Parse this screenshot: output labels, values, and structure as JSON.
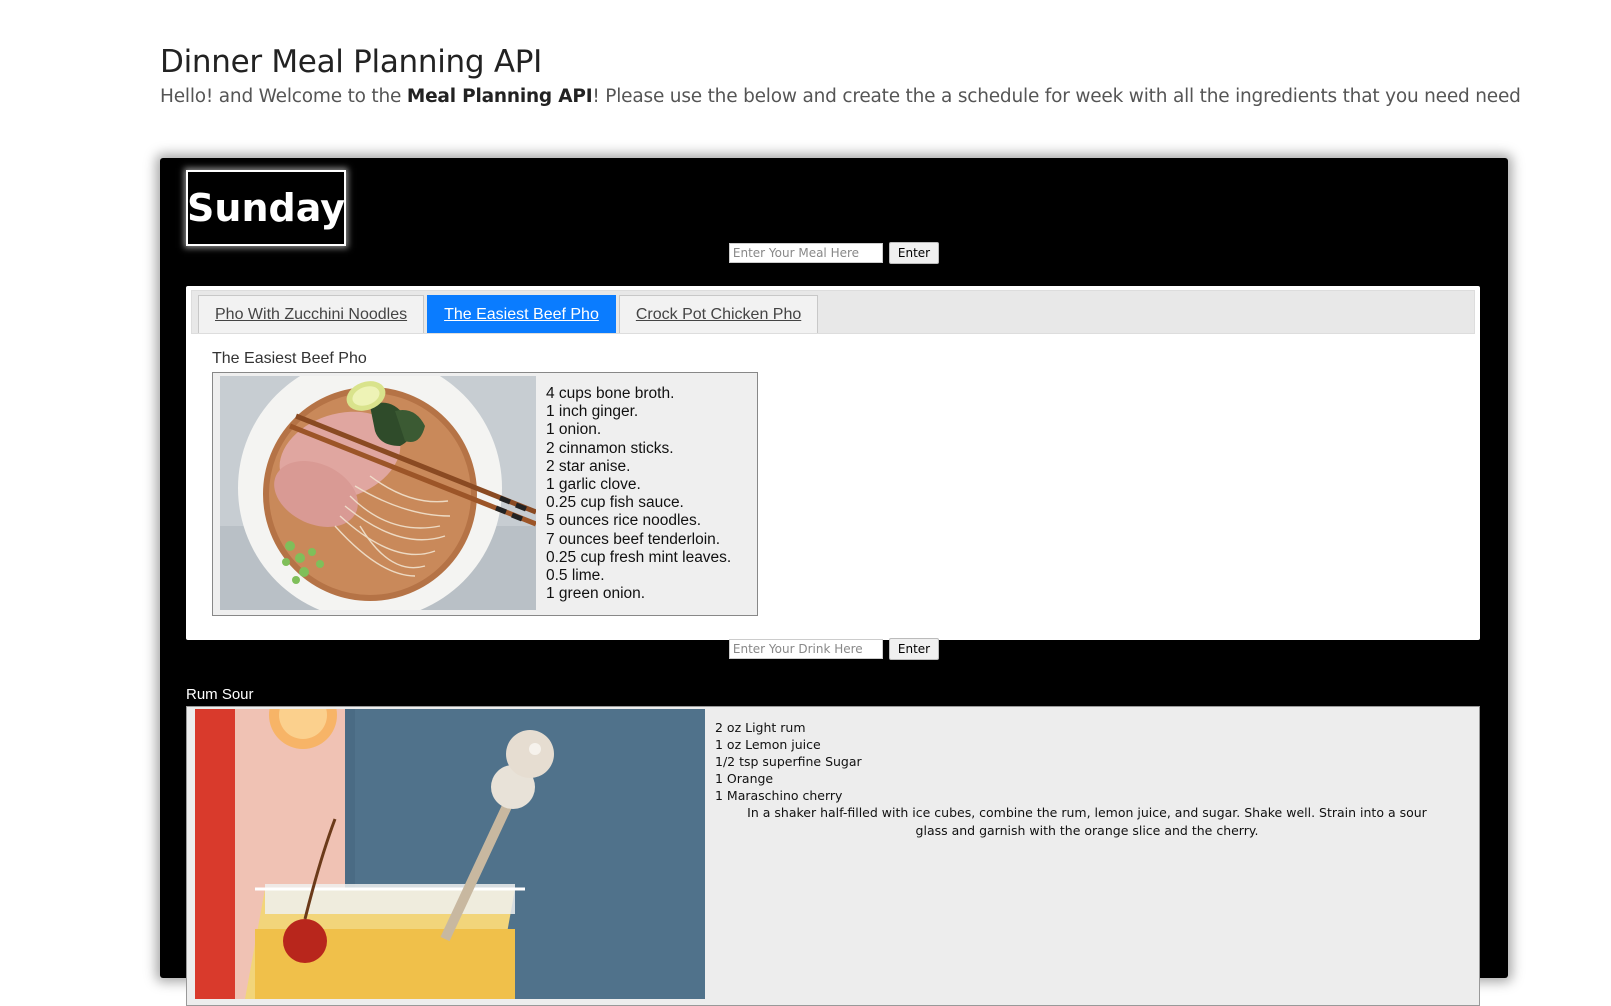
{
  "header": {
    "title": "Dinner Meal Planning API",
    "intro_before": "Hello! and Welcome to the ",
    "intro_bold": "Meal Planning API",
    "intro_after": "! Please use the below and create the a schedule for week with all the ingredients that you need need"
  },
  "day": {
    "name": "Sunday",
    "meal_input_placeholder": "Enter Your Meal Here",
    "drink_input_placeholder": "Enter Your Drink Here",
    "enter_label": "Enter",
    "tabs": [
      {
        "label": "Pho With Zucchini Noodles",
        "active": false
      },
      {
        "label": "The Easiest Beef Pho",
        "active": true
      },
      {
        "label": "Crock Pot Chicken Pho",
        "active": false
      }
    ],
    "active_recipe": {
      "name": "The Easiest Beef Pho",
      "image": "beef-pho-photo",
      "ingredients": [
        "4 cups bone broth.",
        "1 inch ginger.",
        "1 onion.",
        "2 cinnamon sticks.",
        "2 star anise.",
        "1 garlic clove.",
        "0.25 cup fish sauce.",
        "5 ounces rice noodles.",
        "7 ounces beef tenderloin.",
        "0.25 cup fresh mint leaves.",
        "0.5 lime.",
        "1 green onion."
      ]
    },
    "drink": {
      "name": "Rum Sour",
      "image": "rum-sour-photo",
      "ingredients": [
        "2 oz Light rum",
        "1 oz Lemon juice",
        "1/2 tsp superfine Sugar",
        "1 Orange",
        "1 Maraschino cherry"
      ],
      "instructions": "In a shaker half-filled with ice cubes, combine the rum, lemon juice, and sugar. Shake well. Strain into a sour glass and garnish with the orange slice and the cherry."
    }
  },
  "colors": {
    "panel_bg": "#000000",
    "active_tab": "#0a7cff",
    "card_bg": "#efefef"
  }
}
